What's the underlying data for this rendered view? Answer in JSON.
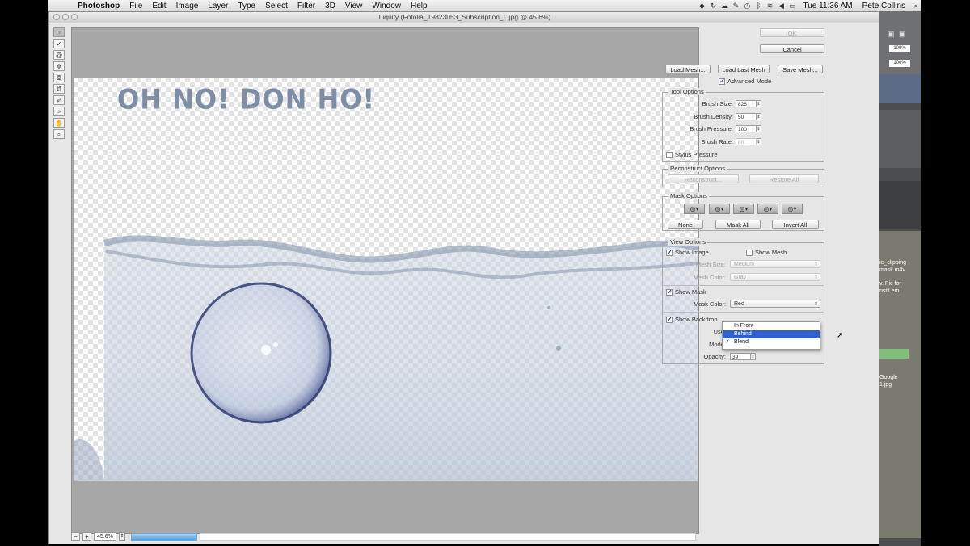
{
  "menubar": {
    "app": "Photoshop",
    "items": [
      "File",
      "Edit",
      "Image",
      "Layer",
      "Type",
      "Select",
      "Filter",
      "3D",
      "View",
      "Window",
      "Help"
    ],
    "clock": "Tue 11:36 AM",
    "user": "Pete Collins"
  },
  "window": {
    "title": "Liquify (Fotolia_19823053_Subscription_L.jpg @ 45.6%)"
  },
  "canvas": {
    "headline": "OH NO! DON HO!"
  },
  "status": {
    "zoom": "45.6%"
  },
  "panel": {
    "ok": "OK",
    "cancel": "Cancel",
    "load_mesh": "Load Mesh...",
    "load_last_mesh": "Load Last Mesh",
    "save_mesh": "Save Mesh...",
    "advanced_mode": "Advanced Mode",
    "tool_options": {
      "legend": "Tool Options",
      "brush_size_label": "Brush Size:",
      "brush_size": "828",
      "brush_density_label": "Brush Density:",
      "brush_density": "50",
      "brush_pressure_label": "Brush Pressure:",
      "brush_pressure": "100",
      "brush_rate_label": "Brush Rate:",
      "brush_rate": "80",
      "stylus_pressure": "Stylus Pressure"
    },
    "reconstruct": {
      "legend": "Reconstruct Options",
      "reconstruct": "Reconstruct...",
      "restore_all": "Restore All"
    },
    "mask": {
      "legend": "Mask Options",
      "none": "None",
      "mask_all": "Mask All",
      "invert_all": "Invert All"
    },
    "view": {
      "legend": "View Options",
      "show_image": "Show Image",
      "show_mesh": "Show Mesh",
      "mesh_size_label": "Mesh Size:",
      "mesh_size": "Medium",
      "mesh_color_label": "Mesh Color:",
      "mesh_color": "Gray",
      "show_mask": "Show Mask",
      "mask_color_label": "Mask Color:",
      "mask_color": "Red",
      "show_backdrop": "Show Backdrop",
      "use_label": "Use:",
      "mode_label": "Mode:",
      "opacity_label": "Opacity:",
      "opacity": "39"
    },
    "popup": {
      "options": [
        "In Front",
        "Behind",
        "Blend"
      ],
      "highlighted": "Behind",
      "checked": "Blend"
    }
  },
  "background": {
    "opacity_value": "100%",
    "fill_value": "100%",
    "file1": "ie_clipping",
    "file2": "mask.m4v",
    "file3": "v. Pic for",
    "file4": "ristiLeml",
    "file5": "Google",
    "file6": "1.jpg"
  },
  "colors": {
    "accent": "#2f5fd0",
    "progress": "#4f9ee0",
    "canvas_gray": "#a7a7a7"
  }
}
